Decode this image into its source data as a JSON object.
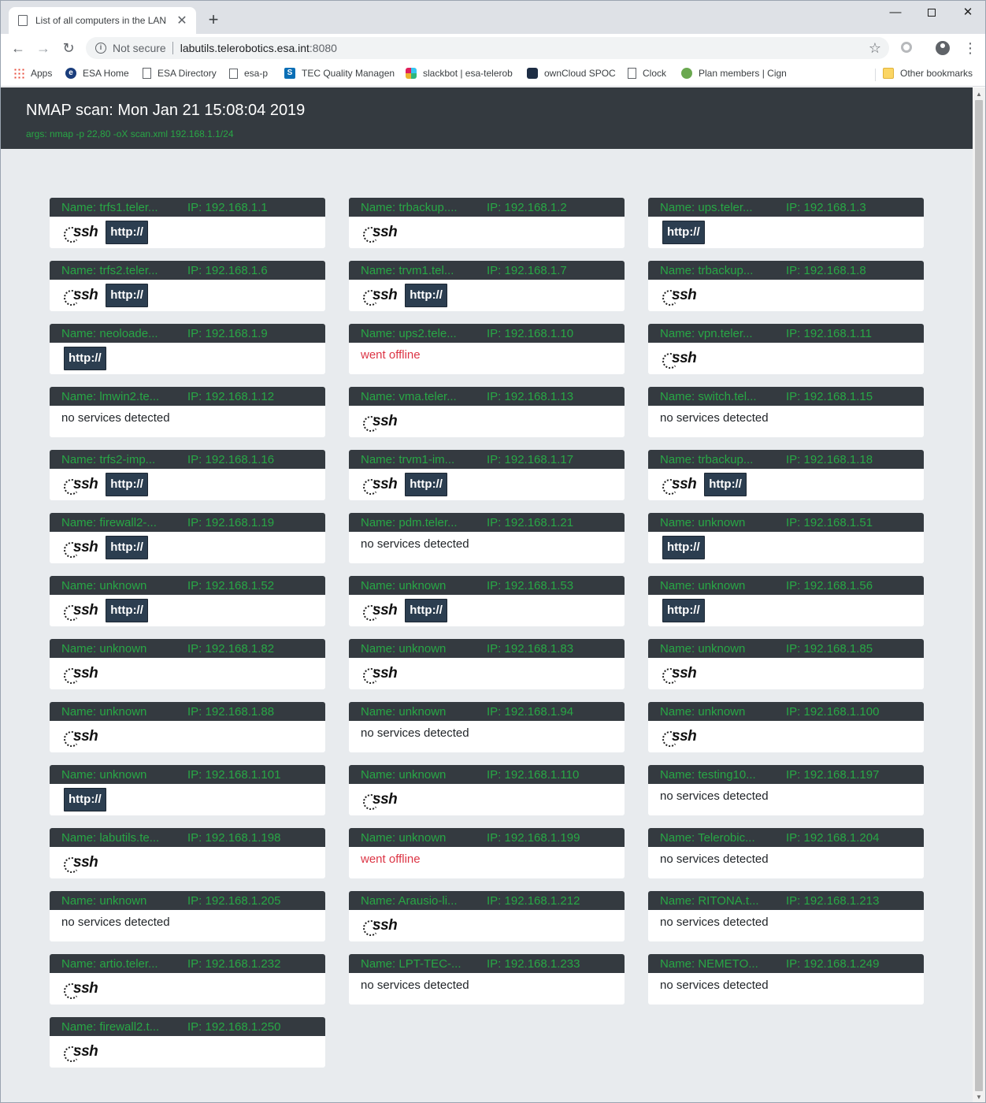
{
  "browser": {
    "tab_title": "List of all computers in the LAN",
    "tab_close": "✕",
    "new_tab": "+",
    "not_secure": "Not secure",
    "url_host": "labutils.telerobotics.esa.int",
    "url_port": ":8080",
    "bookmarks": [
      "Apps",
      "ESA Home",
      "ESA Directory",
      "esa-p",
      "TEC Quality Managen",
      "slackbot | esa-telerob",
      "ownCloud SPOC",
      "Clock",
      "Plan members | Cign",
      "Other bookmarks"
    ]
  },
  "page": {
    "title": "NMAP scan: Mon Jan 21 15:08:04 2019",
    "args": "args: nmap -p 22,80 -oX scan.xml 192.168.1.1/24"
  },
  "labels": {
    "ssh": "ssh",
    "http": "http://",
    "none": "no services detected",
    "offline": "went offline"
  },
  "hosts": [
    {
      "name": "Name: trfs1.teler...",
      "ip": "IP: 192.168.1.1",
      "ssh": true,
      "http": true,
      "status": ""
    },
    {
      "name": "Name: trbackup....",
      "ip": "IP: 192.168.1.2",
      "ssh": true,
      "http": false,
      "status": ""
    },
    {
      "name": "Name: ups.teler...",
      "ip": "IP: 192.168.1.3",
      "ssh": false,
      "http": true,
      "status": ""
    },
    {
      "name": "Name: trfs2.teler...",
      "ip": "IP: 192.168.1.6",
      "ssh": true,
      "http": true,
      "status": ""
    },
    {
      "name": "Name: trvm1.tel...",
      "ip": "IP: 192.168.1.7",
      "ssh": true,
      "http": true,
      "status": ""
    },
    {
      "name": "Name: trbackup...",
      "ip": "IP: 192.168.1.8",
      "ssh": true,
      "http": false,
      "status": ""
    },
    {
      "name": "Name: neoloade...",
      "ip": "IP: 192.168.1.9",
      "ssh": false,
      "http": true,
      "status": ""
    },
    {
      "name": "Name: ups2.tele...",
      "ip": "IP: 192.168.1.10",
      "ssh": false,
      "http": false,
      "status": "offline"
    },
    {
      "name": "Name: vpn.teler...",
      "ip": "IP: 192.168.1.11",
      "ssh": true,
      "http": false,
      "status": ""
    },
    {
      "name": "Name: lmwin2.te...",
      "ip": "IP: 192.168.1.12",
      "ssh": false,
      "http": false,
      "status": "none"
    },
    {
      "name": "Name: vma.teler...",
      "ip": "IP: 192.168.1.13",
      "ssh": true,
      "http": false,
      "status": ""
    },
    {
      "name": "Name: switch.tel...",
      "ip": "IP: 192.168.1.15",
      "ssh": false,
      "http": false,
      "status": "none"
    },
    {
      "name": "Name: trfs2-imp...",
      "ip": "IP: 192.168.1.16",
      "ssh": true,
      "http": true,
      "status": ""
    },
    {
      "name": "Name: trvm1-im...",
      "ip": "IP: 192.168.1.17",
      "ssh": true,
      "http": true,
      "status": ""
    },
    {
      "name": "Name: trbackup...",
      "ip": "IP: 192.168.1.18",
      "ssh": true,
      "http": true,
      "status": ""
    },
    {
      "name": "Name: firewall2-...",
      "ip": "IP: 192.168.1.19",
      "ssh": true,
      "http": true,
      "status": ""
    },
    {
      "name": "Name: pdm.teler...",
      "ip": "IP: 192.168.1.21",
      "ssh": false,
      "http": false,
      "status": "none"
    },
    {
      "name": "Name: unknown",
      "ip": "IP: 192.168.1.51",
      "ssh": false,
      "http": true,
      "status": ""
    },
    {
      "name": "Name: unknown",
      "ip": "IP: 192.168.1.52",
      "ssh": true,
      "http": true,
      "status": ""
    },
    {
      "name": "Name: unknown",
      "ip": "IP: 192.168.1.53",
      "ssh": true,
      "http": true,
      "status": ""
    },
    {
      "name": "Name: unknown",
      "ip": "IP: 192.168.1.56",
      "ssh": false,
      "http": true,
      "status": ""
    },
    {
      "name": "Name: unknown",
      "ip": "IP: 192.168.1.82",
      "ssh": true,
      "http": false,
      "status": ""
    },
    {
      "name": "Name: unknown",
      "ip": "IP: 192.168.1.83",
      "ssh": true,
      "http": false,
      "status": ""
    },
    {
      "name": "Name: unknown",
      "ip": "IP: 192.168.1.85",
      "ssh": true,
      "http": false,
      "status": ""
    },
    {
      "name": "Name: unknown",
      "ip": "IP: 192.168.1.88",
      "ssh": true,
      "http": false,
      "status": ""
    },
    {
      "name": "Name: unknown",
      "ip": "IP: 192.168.1.94",
      "ssh": false,
      "http": false,
      "status": "none"
    },
    {
      "name": "Name: unknown",
      "ip": "IP: 192.168.1.100",
      "ssh": true,
      "http": false,
      "status": ""
    },
    {
      "name": "Name: unknown",
      "ip": "IP: 192.168.1.101",
      "ssh": false,
      "http": true,
      "status": ""
    },
    {
      "name": "Name: unknown",
      "ip": "IP: 192.168.1.110",
      "ssh": true,
      "http": false,
      "status": ""
    },
    {
      "name": "Name: testing10...",
      "ip": "IP: 192.168.1.197",
      "ssh": false,
      "http": false,
      "status": "none"
    },
    {
      "name": "Name: labutils.te...",
      "ip": "IP: 192.168.1.198",
      "ssh": true,
      "http": false,
      "status": ""
    },
    {
      "name": "Name: unknown",
      "ip": "IP: 192.168.1.199",
      "ssh": false,
      "http": false,
      "status": "offline"
    },
    {
      "name": "Name: Telerobic...",
      "ip": "IP: 192.168.1.204",
      "ssh": false,
      "http": false,
      "status": "none"
    },
    {
      "name": "Name: unknown",
      "ip": "IP: 192.168.1.205",
      "ssh": false,
      "http": false,
      "status": "none"
    },
    {
      "name": "Name: Arausio-li...",
      "ip": "IP: 192.168.1.212",
      "ssh": true,
      "http": false,
      "status": ""
    },
    {
      "name": "Name: RITONA.t...",
      "ip": "IP: 192.168.1.213",
      "ssh": false,
      "http": false,
      "status": "none"
    },
    {
      "name": "Name: artio.teler...",
      "ip": "IP: 192.168.1.232",
      "ssh": true,
      "http": false,
      "status": ""
    },
    {
      "name": "Name: LPT-TEC-...",
      "ip": "IP: 192.168.1.233",
      "ssh": false,
      "http": false,
      "status": "none"
    },
    {
      "name": "Name: NEMETO...",
      "ip": "IP: 192.168.1.249",
      "ssh": false,
      "http": false,
      "status": "none"
    },
    {
      "name": "Name: firewall2.t...",
      "ip": "IP: 192.168.1.250",
      "ssh": true,
      "http": false,
      "status": ""
    }
  ]
}
